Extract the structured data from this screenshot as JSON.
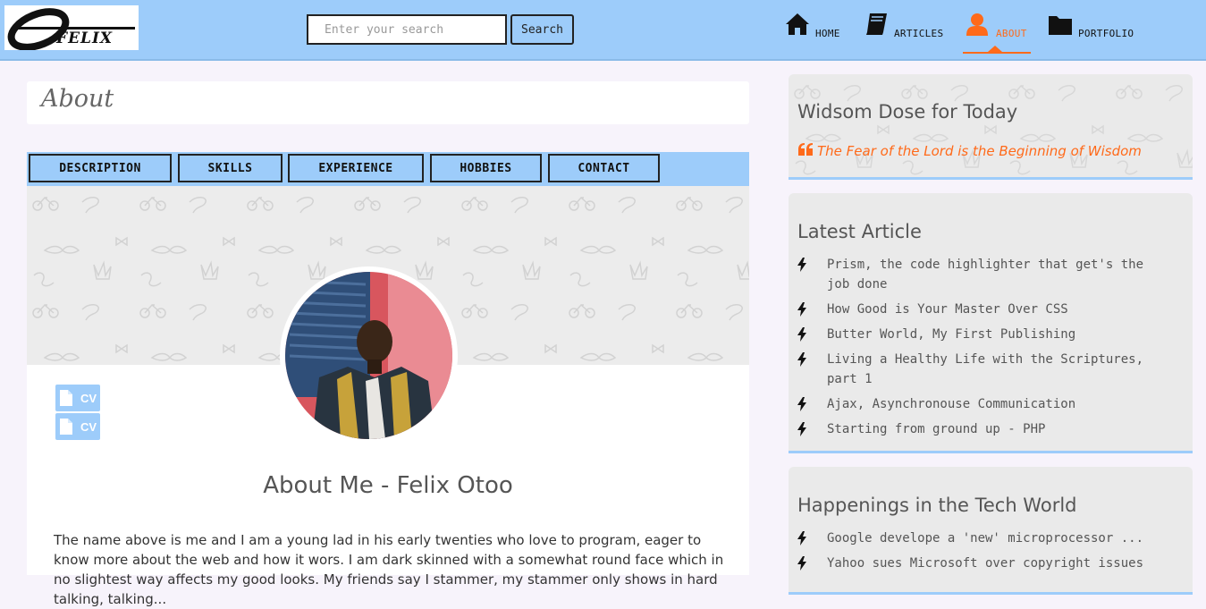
{
  "header": {
    "logo_text": "OFELIX",
    "search": {
      "placeholder": "Enter your search",
      "value": "",
      "button_label": "Search"
    },
    "nav": [
      {
        "label": "HOME",
        "icon": "home-icon",
        "active": false
      },
      {
        "label": "ARTICLES",
        "icon": "book-icon",
        "active": false
      },
      {
        "label": "ABOUT",
        "icon": "user-icon",
        "active": true
      },
      {
        "label": "PORTFOLIO",
        "icon": "folder-icon",
        "active": false
      }
    ]
  },
  "colors": {
    "header_bg": "#9dccfa",
    "accent": "#ff6a1a",
    "panel_bg": "#eaeaea"
  },
  "main": {
    "page_title": "About",
    "tabs": [
      {
        "label": "DESCRIPTION"
      },
      {
        "label": "SKILLS"
      },
      {
        "label": "EXPERIENCE"
      },
      {
        "label": "HOBBIES"
      },
      {
        "label": "CONTACT"
      }
    ],
    "cv_buttons": [
      {
        "label": "CV",
        "icon": "file-icon"
      },
      {
        "label": "CV",
        "icon": "file-icon"
      }
    ],
    "heading": "About Me - Felix Otoo",
    "paragraph": "The name above is me and I am a young lad in his early twenties who love to program, eager to know more about the web and how it wors. I am dark skinned with a somewhat round face which in no slightest way affects my good looks. My friends say I stammer, my stammer only shows in hard talking, talking..."
  },
  "sidebar": {
    "wisdom": {
      "title": "Widsom Dose for Today",
      "quote": "The Fear of the Lord is the Beginning of Wisdom"
    },
    "latest": {
      "title": "Latest Article",
      "items": [
        "Prism, the code highlighter that get's the job done",
        "How Good is Your Master Over CSS",
        "Butter World, My First Publishing",
        "Living a Healthy Life with the Scriptures, part 1",
        "Ajax, Asynchronouse Communication",
        "Starting from ground up - PHP"
      ]
    },
    "tech": {
      "title": "Happenings in the Tech World",
      "items": [
        "Google develope a 'new' microprocessor ...",
        "Yahoo sues Microsoft over copyright issues"
      ]
    }
  }
}
